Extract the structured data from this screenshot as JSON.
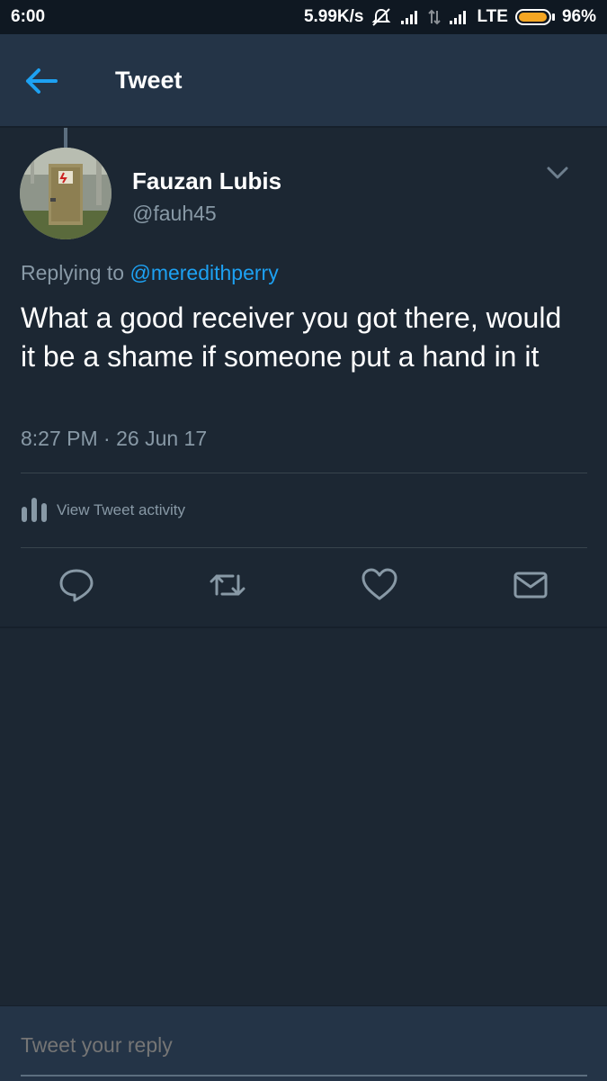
{
  "status_bar": {
    "time": "6:00",
    "network_speed": "5.99K/s",
    "network_type": "LTE",
    "battery_percent": "96%",
    "battery_level": 0.96,
    "battery_color": "#f5a623"
  },
  "header": {
    "title": "Tweet",
    "accent_color": "#1da1f2"
  },
  "tweet": {
    "author_name": "Fauzan Lubis",
    "author_handle": "@fauh45",
    "replying_prefix": "Replying to",
    "replying_to": "@meredithperry",
    "text": "What a good receiver you got there, would it be a shame if someone put a hand in it",
    "timestamp": "8:27 PM · 26 Jun 17",
    "activity_label": "View Tweet activity"
  },
  "actions": [
    {
      "name": "reply-icon"
    },
    {
      "name": "retweet-icon"
    },
    {
      "name": "like-icon"
    },
    {
      "name": "message-icon"
    }
  ],
  "reply_bar": {
    "placeholder": "Tweet your reply"
  }
}
